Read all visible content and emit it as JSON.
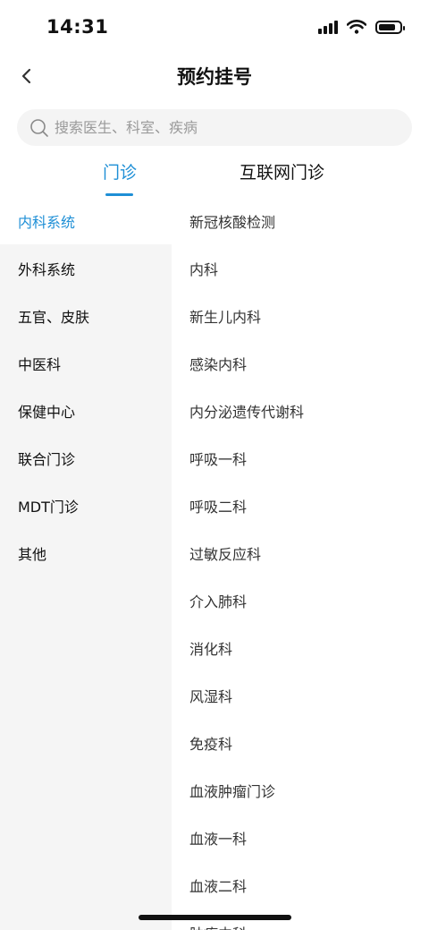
{
  "status_bar": {
    "time": "14:31"
  },
  "header": {
    "title": "预约挂号"
  },
  "search": {
    "placeholder": "搜索医生、科室、疾病"
  },
  "tabs": [
    {
      "label": "门诊",
      "active": true
    },
    {
      "label": "互联网门诊",
      "active": false
    }
  ],
  "categories": [
    {
      "label": "内科系统",
      "active": true
    },
    {
      "label": "外科系统"
    },
    {
      "label": "五官、皮肤"
    },
    {
      "label": "中医科"
    },
    {
      "label": "保健中心"
    },
    {
      "label": "联合门诊"
    },
    {
      "label": "MDT门诊"
    },
    {
      "label": "其他"
    }
  ],
  "departments": [
    "新冠核酸检测",
    "内科",
    "新生儿内科",
    "感染内科",
    "内分泌遗传代谢科",
    "呼吸一科",
    "呼吸二科",
    "过敏反应科",
    "介入肺科",
    "消化科",
    "风湿科",
    "免疫科",
    "血液肿瘤门诊",
    "血液一科",
    "血液二科",
    "肿瘤内科"
  ],
  "colors": {
    "accent": "#1e8fd6",
    "sidebar_bg": "#f5f5f5",
    "search_bg": "#f4f4f4"
  },
  "icons": [
    "back-arrow-icon",
    "search-icon",
    "signal-icon",
    "wifi-icon",
    "battery-icon"
  ]
}
